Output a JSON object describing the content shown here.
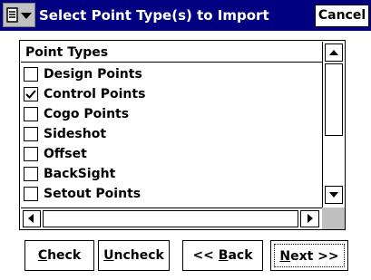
{
  "window": {
    "title": "Select Point Type(s) to Import",
    "cancel_label": "Cancel",
    "menu_icon": "menu-dropdown-icon"
  },
  "list": {
    "header": "Point Types",
    "items": [
      {
        "label": "Design Points",
        "checked": false
      },
      {
        "label": "Control Points",
        "checked": true
      },
      {
        "label": "Cogo Points",
        "checked": false
      },
      {
        "label": "Sideshot",
        "checked": false
      },
      {
        "label": "Offset",
        "checked": false
      },
      {
        "label": "BackSight",
        "checked": false
      },
      {
        "label": "Setout Points",
        "checked": false
      }
    ]
  },
  "buttons": {
    "check": {
      "mnemonic": "C",
      "rest": "heck"
    },
    "uncheck": {
      "mnemonic": "U",
      "rest": "ncheck"
    },
    "back": {
      "pre": "<< ",
      "mnemonic": "B",
      "rest": "ack"
    },
    "next": {
      "mnemonic": "N",
      "rest": "ext >>"
    }
  },
  "colors": {
    "titlebar": "#000080",
    "face": "#c0c0c0"
  }
}
